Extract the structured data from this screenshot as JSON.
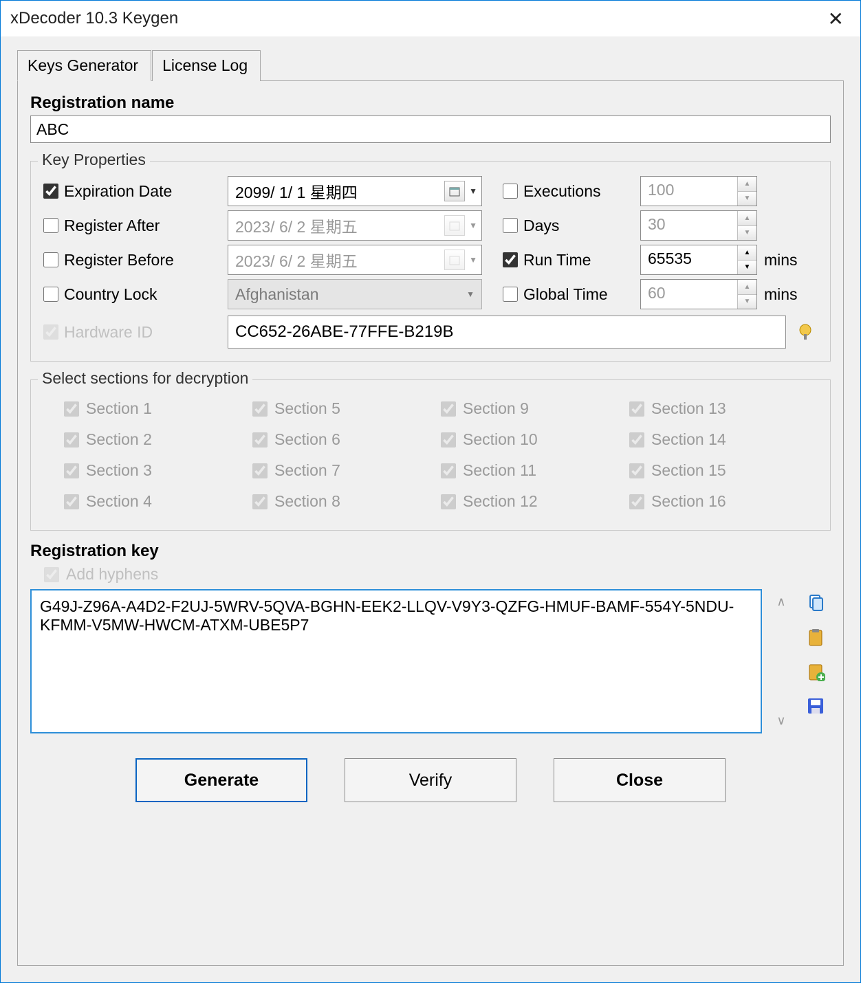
{
  "window": {
    "title": "xDecoder 10.3 Keygen"
  },
  "tabs": {
    "keys_generator": "Keys Generator",
    "license_log": "License Log"
  },
  "registration_name": {
    "label": "Registration name",
    "value": "ABC"
  },
  "key_properties": {
    "legend": "Key Properties",
    "expiration_date": {
      "label": "Expiration Date",
      "value": "2099/ 1/ 1 星期四"
    },
    "register_after": {
      "label": "Register After",
      "value": "2023/ 6/ 2 星期五"
    },
    "register_before": {
      "label": "Register Before",
      "value": "2023/ 6/ 2 星期五"
    },
    "country_lock": {
      "label": "Country Lock",
      "value": "Afghanistan"
    },
    "executions": {
      "label": "Executions",
      "value": "100"
    },
    "days": {
      "label": "Days",
      "value": "30"
    },
    "run_time": {
      "label": "Run Time",
      "value": "65535",
      "unit": "mins"
    },
    "global_time": {
      "label": "Global Time",
      "value": "60",
      "unit": "mins"
    },
    "hardware_id": {
      "label": "Hardware ID",
      "value": "CC652-26ABE-77FFE-B219B"
    }
  },
  "sections": {
    "legend": "Select sections for decryption",
    "items": [
      "Section 1",
      "Section 5",
      "Section 9",
      "Section 13",
      "Section 2",
      "Section 6",
      "Section 10",
      "Section 14",
      "Section 3",
      "Section 7",
      "Section 11",
      "Section 15",
      "Section 4",
      "Section 8",
      "Section 12",
      "Section 16"
    ]
  },
  "registration_key": {
    "label": "Registration key",
    "add_hyphens": "Add hyphens",
    "value": "G49J-Z96A-A4D2-F2UJ-5WRV-5QVA-BGHN-EEK2-LLQV-V9Y3-QZFG-HMUF-BAMF-554Y-5NDU-KFMM-V5MW-HWCM-ATXM-UBE5P7"
  },
  "buttons": {
    "generate": "Generate",
    "verify": "Verify",
    "close": "Close"
  }
}
